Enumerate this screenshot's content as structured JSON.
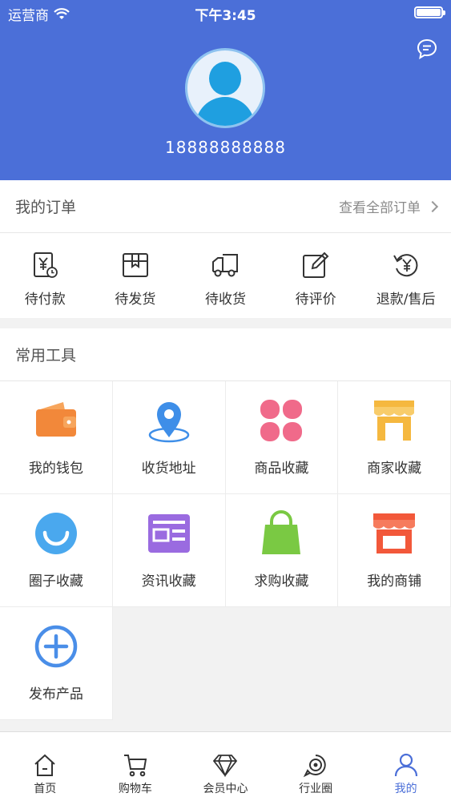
{
  "status_bar": {
    "carrier": "运营商",
    "time": "下午3:45",
    "battery_level": 1.0
  },
  "profile": {
    "phone": "18888888888"
  },
  "orders": {
    "title": "我的订单",
    "view_all": "查看全部订单",
    "items": [
      {
        "label": "待付款",
        "icon": "pending-payment-icon"
      },
      {
        "label": "待发货",
        "icon": "pending-shipment-icon"
      },
      {
        "label": "待收货",
        "icon": "pending-receipt-icon"
      },
      {
        "label": "待评价",
        "icon": "pending-review-icon"
      },
      {
        "label": "退款/售后",
        "icon": "refund-icon"
      }
    ]
  },
  "tools": {
    "title": "常用工具",
    "items": [
      {
        "label": "我的钱包",
        "icon": "wallet-icon",
        "color": "#f2883a"
      },
      {
        "label": "收货地址",
        "icon": "location-icon",
        "color": "#3e8ee8"
      },
      {
        "label": "商品收藏",
        "icon": "clover-icon",
        "color": "#f06a8a"
      },
      {
        "label": "商家收藏",
        "icon": "shop-icon",
        "color": "#f5b83f"
      },
      {
        "label": "圈子收藏",
        "icon": "smile-circle-icon",
        "color": "#4aa8ee"
      },
      {
        "label": "资讯收藏",
        "icon": "news-icon",
        "color": "#9a6be0"
      },
      {
        "label": "求购收藏",
        "icon": "bag-icon",
        "color": "#7ac943"
      },
      {
        "label": "我的商铺",
        "icon": "store-icon",
        "color": "#f2583a"
      },
      {
        "label": "发布产品",
        "icon": "plus-circle-icon",
        "color": "#4a8ee8"
      }
    ]
  },
  "tabbar": {
    "items": [
      {
        "label": "首页",
        "icon": "home-icon"
      },
      {
        "label": "购物车",
        "icon": "cart-icon"
      },
      {
        "label": "会员中心",
        "icon": "diamond-icon"
      },
      {
        "label": "行业圈",
        "icon": "circle-icon"
      },
      {
        "label": "我的",
        "icon": "user-icon",
        "active": true
      }
    ]
  },
  "colors": {
    "primary": "#4b6fd8",
    "avatar": "#1f9fe0"
  }
}
